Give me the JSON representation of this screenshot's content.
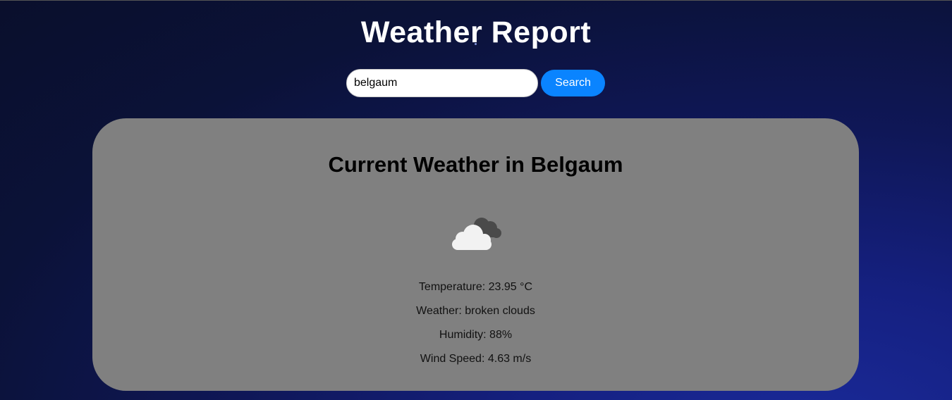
{
  "header": {
    "title": "Weather Report"
  },
  "search": {
    "value": "belgaum",
    "button_label": "Search"
  },
  "card": {
    "heading": "Current Weather in Belgaum",
    "icon": "broken-clouds-icon",
    "temperature_label": "Temperature",
    "temperature_value": "23.95 °C",
    "weather_label": "Weather",
    "weather_value": "broken clouds",
    "humidity_label": "Humidity",
    "humidity_value": "88%",
    "wind_label": "Wind Speed",
    "wind_value": "4.63 m/s"
  },
  "colors": {
    "background": "#0b1238",
    "card": "#808080",
    "button": "#0a84ff",
    "title_text": "#ffffff"
  }
}
